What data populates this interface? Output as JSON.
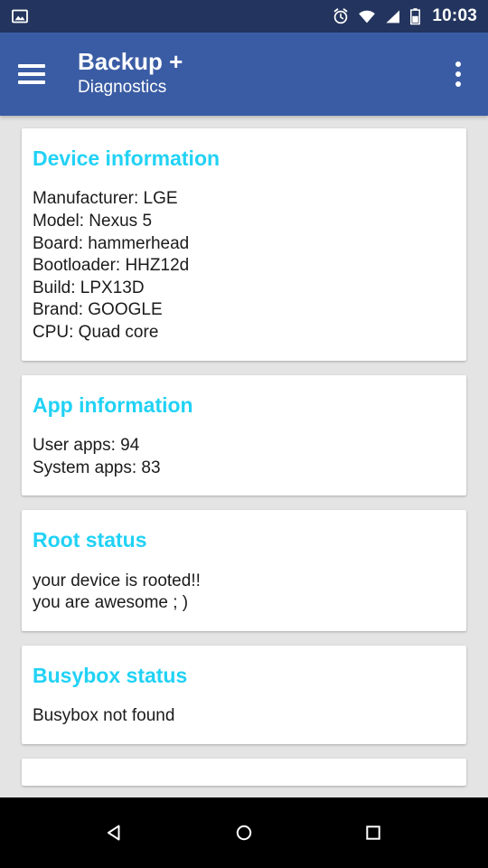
{
  "statusbar": {
    "time": "10:03",
    "icons": [
      "photo-notification-icon",
      "alarm-icon",
      "wifi-icon",
      "signal-icon",
      "battery-icon"
    ]
  },
  "appbar": {
    "menu_icon": "hamburger-menu-icon",
    "title": "Backup +",
    "subtitle": "Diagnostics",
    "overflow_icon": "overflow-menu-icon"
  },
  "colors": {
    "statusbar": "#23355e",
    "appbar": "#3a5ca4",
    "accent": "#21d2f5",
    "background": "#e4e4e4",
    "card": "#ffffff",
    "navbar": "#000000"
  },
  "cards": [
    {
      "title": "Device information",
      "lines": [
        "Manufacturer: LGE",
        "Model: Nexus 5",
        "Board: hammerhead",
        "Bootloader: HHZ12d",
        "Build: LPX13D",
        "Brand: GOOGLE",
        "CPU: Quad core"
      ]
    },
    {
      "title": "App information",
      "lines": [
        "User apps: 94",
        "System apps: 83"
      ]
    },
    {
      "title": "Root status",
      "lines": [
        "your device is rooted!!",
        "you are awesome ; )"
      ]
    },
    {
      "title": "Busybox status",
      "lines": [
        "Busybox not found"
      ]
    }
  ],
  "navbar": {
    "back_label": "back-button",
    "home_label": "home-button",
    "recents_label": "recents-button"
  }
}
